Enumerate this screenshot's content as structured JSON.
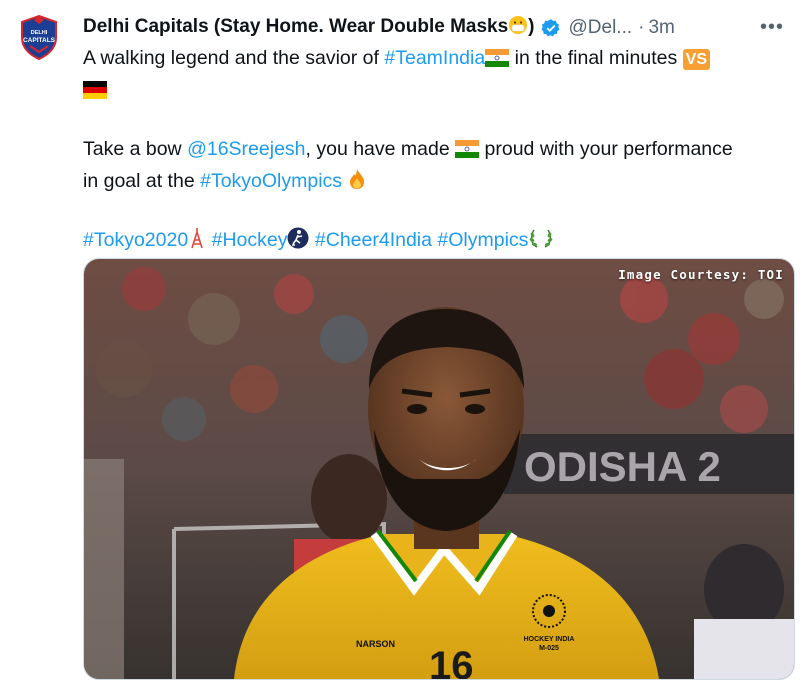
{
  "tweet": {
    "author_name": "Delhi Capitals (Stay Home. Wear Double Masks",
    "name_suffix": ")",
    "handle": "@Del...",
    "separator": "·",
    "time": "3m",
    "more": "•••",
    "avatar_text": "DELHI CAPITALS",
    "lines": {
      "l1_a": "A walking legend and the savior of ",
      "l1_hashtag": "#TeamIndia",
      "l1_b": " in the final minutes ",
      "vs": "VS",
      "l2_a": "Take a bow ",
      "l2_mention": "@16Sreejesh",
      "l2_b": ", you have made ",
      "l2_c": " proud with your performance",
      "l3_a": "in goal at the ",
      "l3_hashtag": "#TokyoOlympics",
      "h1": "#Tokyo2020",
      "h2": "#Hockey",
      "h3": "#Cheer4India",
      "h4": "#Olympics"
    },
    "image": {
      "courtesy": "Image Courtesy: TOI",
      "banner_text": "ODISHA 2",
      "jersey_number": "16",
      "badge_line1": "HOCKEY INDIA",
      "badge_line2": "M-025",
      "brand": "NARSON"
    }
  },
  "colors": {
    "link": "#1d9bf0",
    "secondary": "#536471",
    "verified": "#1d9bf0",
    "jersey": "#e8b71a"
  }
}
